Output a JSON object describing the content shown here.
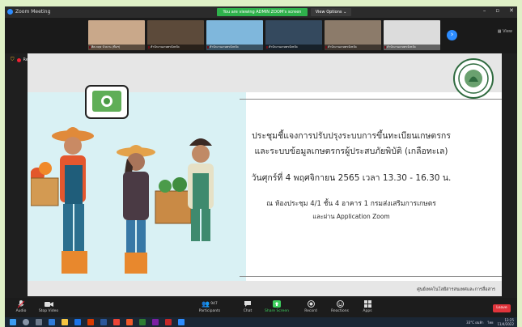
{
  "window": {
    "title": "Zoom Meeting",
    "viewing_banner": "You are viewing ADMIN ZOOM's screen",
    "view_options": "View Options ⌄",
    "gallery_label": "View"
  },
  "participants_strip": [
    {
      "name": "ศิศ.กฤษ บัวบาน (ทีมฯ)",
      "bg": "#c9a88a"
    },
    {
      "name": "สำนักงานเกษตรจังหวัด",
      "bg": "#5c4a3a"
    },
    {
      "name": "สำนักงานเกษตรจังหวัด",
      "bg": "#7fb7dc"
    },
    {
      "name": "สำนักงานเกษตรจังหวัด",
      "bg": "#34495e"
    },
    {
      "name": "สำนักงานเกษตรจังหวัด",
      "bg": "#8c7b6a"
    },
    {
      "name": "สำนักงานเกษตรจังหวัด",
      "bg": "#dcdcdc"
    }
  ],
  "recording_label": "Recording",
  "slide": {
    "line1": "ประชุมชี้แจงการปรับปรุงระบบการขึ้นทะเบียนเกษตรกร",
    "line2": "และระบบข้อมูลเกษตรกรผู้ประสบภัยพิบัติ (เกลือทะเล)",
    "date_line": "วันศุกร์ที่ 4 พฤศจิกายน 2565 เวลา 13.30 - 16.30 น.",
    "venue_line": "ณ ห้องประชุม 4/1 ชั้น 4 อาคาร 1 กรมส่งเสริมการเกษตร",
    "via_line": "และผ่าน Application Zoom",
    "footer": "ศูนย์เทคโนโลยีสารสนเทศและการสื่อสาร"
  },
  "toolbar": {
    "audio": "Audio",
    "stop_video": "Stop Video",
    "participants": "Participants",
    "participants_count": "947",
    "chat": "Chat",
    "share_screen": "Share Screen",
    "record": "Record",
    "reactions": "Reactions",
    "apps": "Apps",
    "leave": "Leave"
  },
  "taskbar": {
    "weather": "33°C ฝนฟ้า",
    "lang": "ไทย",
    "time": "13:25",
    "date": "11/4/2022"
  },
  "colors": {
    "zoom_blue": "#2d8cff",
    "share_green": "#3ecf5e",
    "leave_red": "#e0343b",
    "banner_green": "#2fb24c"
  }
}
